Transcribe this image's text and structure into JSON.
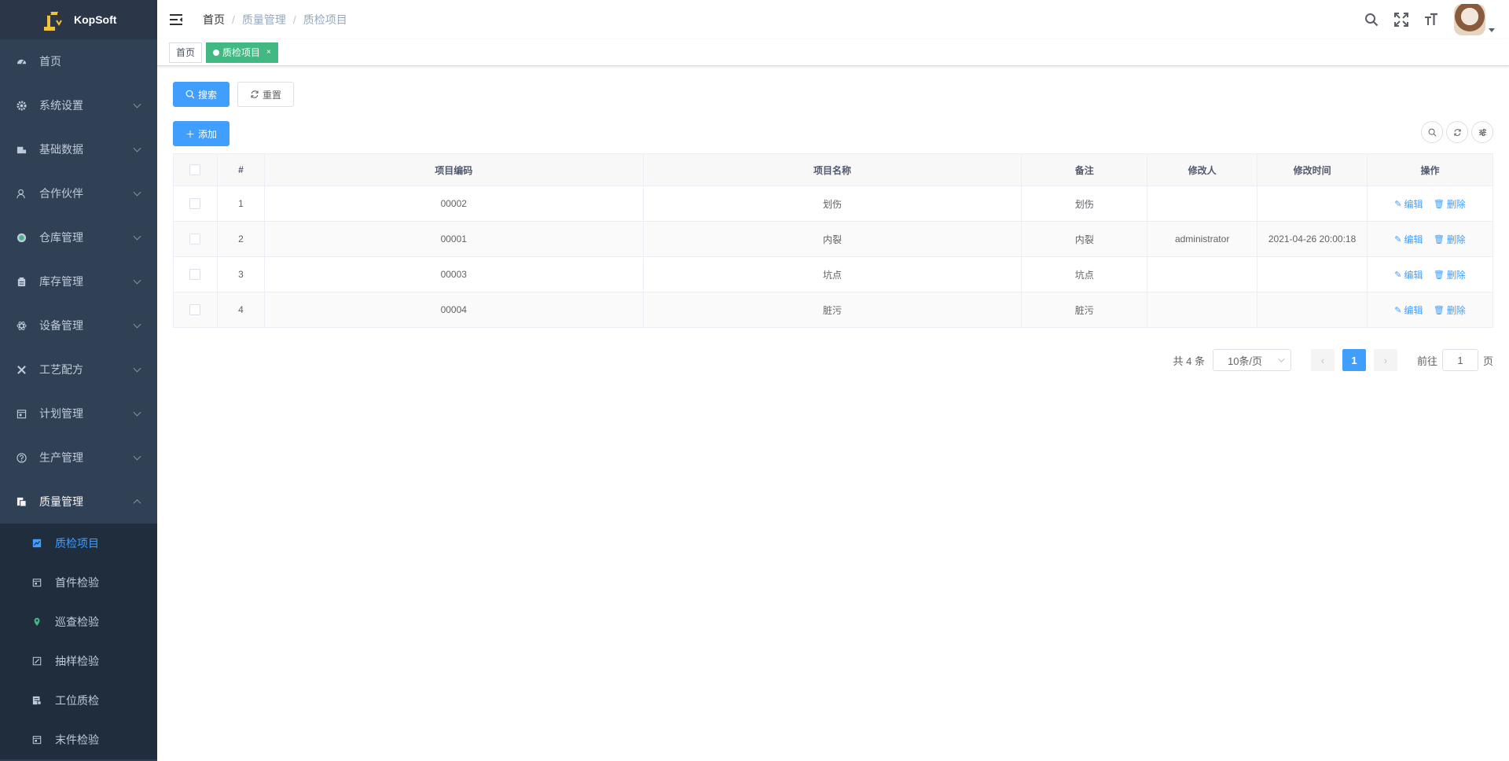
{
  "app": {
    "logo_title": "KopSoft"
  },
  "sidebar": {
    "items": [
      {
        "label": "首页",
        "icon": "dashboard-icon"
      },
      {
        "label": "系统设置",
        "icon": "gear-icon"
      },
      {
        "label": "基础数据",
        "icon": "database-icon"
      },
      {
        "label": "合作伙伴",
        "icon": "peoples-icon"
      },
      {
        "label": "仓库管理",
        "icon": "warehouse-icon"
      },
      {
        "label": "库存管理",
        "icon": "inventory-icon"
      },
      {
        "label": "设备管理",
        "icon": "equipment-icon"
      },
      {
        "label": "工艺配方",
        "icon": "tools-icon"
      },
      {
        "label": "计划管理",
        "icon": "plan-icon"
      },
      {
        "label": "生产管理",
        "icon": "question-circle-icon"
      },
      {
        "label": "质量管理",
        "icon": "quality-icon"
      }
    ],
    "quality_children": [
      {
        "label": "质检项目",
        "icon": "chart-icon"
      },
      {
        "label": "首件检验",
        "icon": "form-icon"
      },
      {
        "label": "巡查检验",
        "icon": "location-icon"
      },
      {
        "label": "抽样检验",
        "icon": "edit-icon"
      },
      {
        "label": "工位质检",
        "icon": "station-icon"
      },
      {
        "label": "末件检验",
        "icon": "form-icon"
      }
    ]
  },
  "navbar": {
    "breadcrumb": [
      "首页",
      "质量管理",
      "质检项目"
    ],
    "separator": "/"
  },
  "tags": [
    {
      "label": "首页"
    },
    {
      "label": "质检项目",
      "close": "×"
    }
  ],
  "toolbar": {
    "search_label": "搜索",
    "reset_label": "重置",
    "add_label": "添加"
  },
  "table": {
    "columns": [
      "#",
      "项目编码",
      "项目名称",
      "备注",
      "修改人",
      "修改时间",
      "操作"
    ],
    "rows": [
      {
        "index": "1",
        "code": "00002",
        "name": "划伤",
        "remark": "划伤",
        "modifier": "",
        "modified_at": ""
      },
      {
        "index": "2",
        "code": "00001",
        "name": "内裂",
        "remark": "内裂",
        "modifier": "administrator",
        "modified_at": "2021-04-26 20:00:18"
      },
      {
        "index": "3",
        "code": "00003",
        "name": "坑点",
        "remark": "坑点",
        "modifier": "",
        "modified_at": ""
      },
      {
        "index": "4",
        "code": "00004",
        "name": "脏污",
        "remark": "脏污",
        "modifier": "",
        "modified_at": ""
      }
    ],
    "actions": {
      "edit": "编辑",
      "delete": "删除"
    }
  },
  "pagination": {
    "total_text": "共 4 条",
    "page_size": "10条/页",
    "current_page": "1",
    "goto_prefix": "前往",
    "goto_value": "1",
    "goto_suffix": "页"
  },
  "colors": {
    "sidebar_bg": "#304156",
    "submenu_bg": "#1f2d3d",
    "primary": "#409eff",
    "tag_active": "#42b983"
  }
}
